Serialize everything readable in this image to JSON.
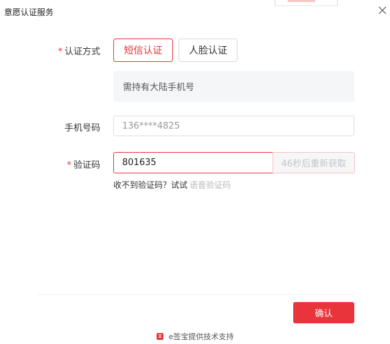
{
  "dialog": {
    "title": "意愿认证服务"
  },
  "form": {
    "method_label": "认证方式",
    "method_options": [
      {
        "label": "短信认证",
        "selected": true
      },
      {
        "label": "人脸认证",
        "selected": false
      }
    ],
    "note": "需持有大陆手机号",
    "phone_label": "手机号码",
    "phone_value": "136****4825",
    "code_label": "验证码",
    "code_value": "801635",
    "resend_label": "46秒后重新获取",
    "hint_text": "收不到验证码？试试",
    "voice_link": "语音验证码",
    "required_mark": "*"
  },
  "actions": {
    "confirm_label": "确认"
  },
  "footer": {
    "text": "e签宝提供技术支持"
  },
  "colors": {
    "accent": "#e8343a",
    "note_bg": "#f5f6f7",
    "muted": "#b5b8be"
  },
  "icons": {
    "close": "close-icon",
    "logo": "esign-logo-icon"
  }
}
